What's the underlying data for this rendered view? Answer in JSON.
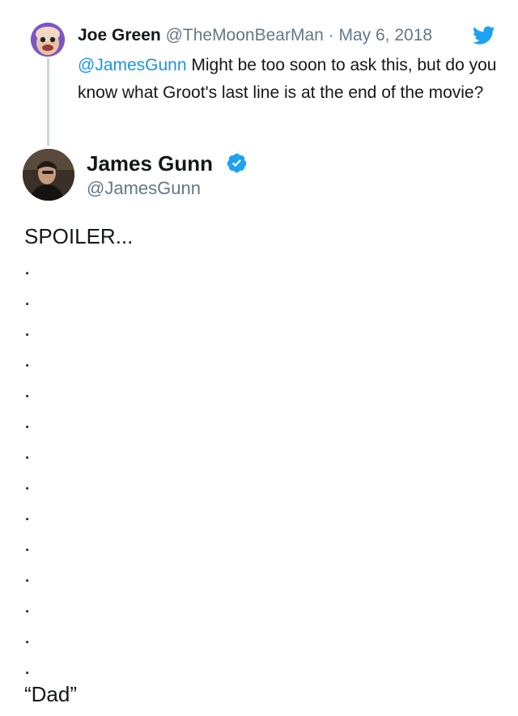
{
  "parent_tweet": {
    "name": "Joe Green",
    "handle": "@TheMoonBearMan",
    "separator": "·",
    "date": "May 6, 2018",
    "mention": "@JamesGunn",
    "text": " Might be too soon to ask this, but do you know what Groot's last line is at the end of the movie?"
  },
  "main_tweet": {
    "name": "James Gunn",
    "handle": "@JamesGunn",
    "first_line": "SPOILER...",
    "dots": [
      ".",
      ".",
      ".",
      ".",
      ".",
      ".",
      ".",
      ".",
      ".",
      ".",
      ".",
      ".",
      ".",
      "."
    ],
    "last_line": "“Dad”"
  },
  "icons": {
    "platform": "twitter-bird-icon",
    "verified": "verified-badge-icon"
  },
  "colors": {
    "link": "#1b95e0",
    "secondary_text": "#657786",
    "primary_text": "#14171a",
    "brand_blue": "#1da1f2",
    "thread_line": "#ccd6dd"
  }
}
